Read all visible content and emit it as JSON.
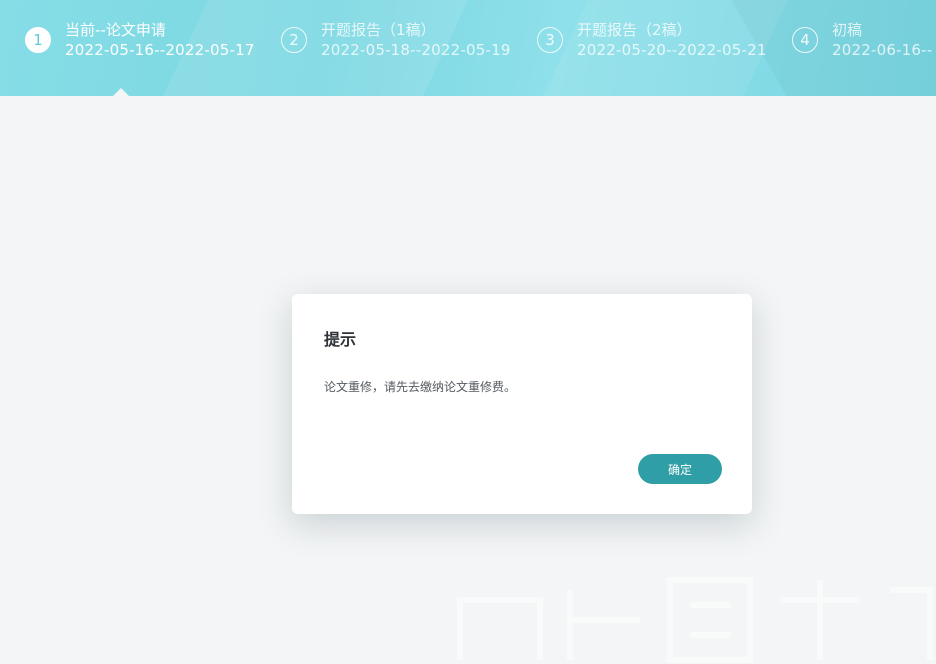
{
  "steps": [
    {
      "number": "1",
      "title": "当前--论文申请",
      "dates": "2022-05-16--2022-05-17",
      "active": true
    },
    {
      "number": "2",
      "title": "开题报告（1稿）",
      "dates": "2022-05-18--2022-05-19",
      "active": false
    },
    {
      "number": "3",
      "title": "开题报告（2稿）",
      "dates": "2022-05-20--2022-05-21",
      "active": false
    },
    {
      "number": "4",
      "title": "初稿",
      "dates": "2022-06-16--",
      "active": false
    }
  ],
  "dialog": {
    "title": "提示",
    "message": "论文重修，请先去缴纳论文重修费。",
    "confirm_label": "确定"
  },
  "colors": {
    "stepbar": "#7ad7e2",
    "confirm_button": "#2f9ea7",
    "background": "#f3f5f6"
  }
}
